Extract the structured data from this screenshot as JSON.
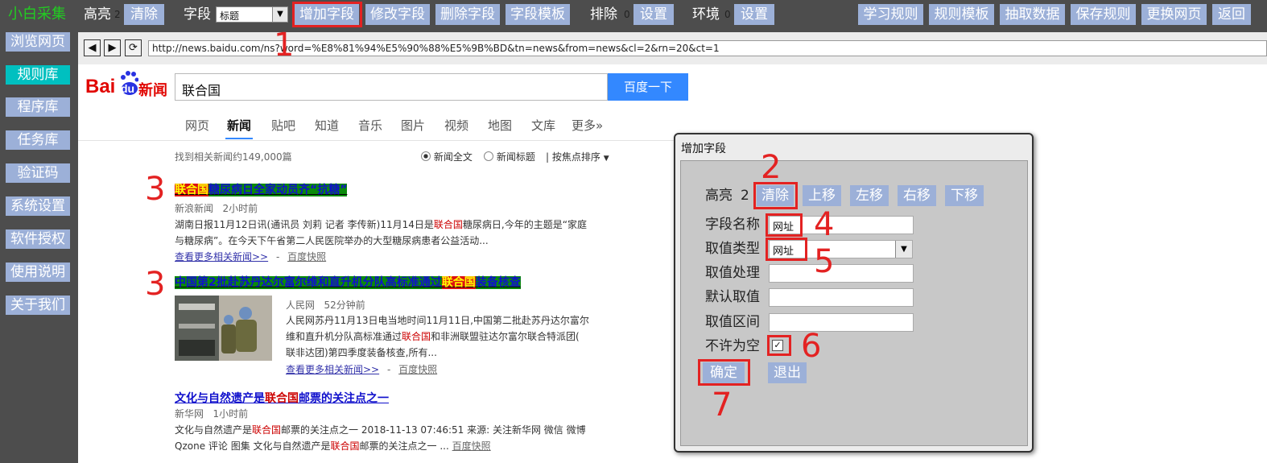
{
  "toolbar": {
    "brand": "小白采集",
    "highlight_label": "高亮",
    "highlight_count": "2",
    "clear": "清除",
    "field_label": "字段",
    "field_select": "标题",
    "add_field": "增加字段",
    "edit_field": "修改字段",
    "delete_field": "删除字段",
    "field_template": "字段模板",
    "exclude_label": "排除",
    "exclude_count": "0",
    "exclude_set": "设置",
    "env_label": "环境",
    "env_count": "0",
    "env_set": "设置",
    "learn_rules": "学习规则",
    "rule_template": "规则模板",
    "extract_data": "抽取数据",
    "save_rules": "保存规则",
    "change_page": "更换网页",
    "back": "返回"
  },
  "sidebar": {
    "items": [
      {
        "label": "浏览网页"
      },
      {
        "label": "规则库"
      },
      {
        "label": "程序库"
      },
      {
        "label": "任务库"
      },
      {
        "label": "验证码"
      },
      {
        "label": "系统设置"
      },
      {
        "label": "软件授权"
      },
      {
        "label": "使用说明"
      },
      {
        "label": "关于我们"
      }
    ]
  },
  "browser": {
    "back_glyph": "◀",
    "forward_glyph": "▶",
    "refresh_glyph": "⟳",
    "url": "http://news.baidu.com/ns?word=%E8%81%94%E5%90%88%E5%9B%BD&tn=news&from=news&cl=2&rn=20&ct=1"
  },
  "baidu": {
    "logo_bai": "Bai",
    "logo_du": "du",
    "logo_news": "新闻",
    "query": "联合国",
    "search_button": "百度一下",
    "tabs": [
      "网页",
      "新闻",
      "贴吧",
      "知道",
      "音乐",
      "图片",
      "视频",
      "地图",
      "文库",
      "更多»"
    ],
    "result_count": "找到相关新闻约149,000篇",
    "option_full": "新闻全文",
    "option_title": "新闻标题",
    "sort": "| 按焦点排序",
    "results": [
      {
        "title_a": "联合国",
        "title_b": "糖尿病日全家动员齐“抗糖”",
        "source": "新浪新闻",
        "time": "2小时前",
        "snippet_1a": "湖南日报11月12日讯(通讯员 刘莉 记者 李传新)11月14日是",
        "snippet_1b": "联合国",
        "snippet_1c": "糖尿病日,今年的主题是“家庭",
        "snippet_2": "与糖尿病”。在今天下午省第二人民医院举办的大型糖尿病患者公益活动...",
        "more": "查看更多相关新闻>>",
        "sep": "-",
        "cache": "百度快照"
      },
      {
        "title_a": "中国第2批赴苏丹达尔富尔维和直升机分队高标准通过",
        "title_b": "联合国",
        "title_c": "装备核查",
        "source": "人民网",
        "time": "52分钟前",
        "snippet_1": "人民网苏丹11月13日电当地时间11月11日,中国第二批赴苏丹达尔富尔",
        "snippet_2a": "维和直升机分队高标准通过",
        "snippet_2b": "联合国",
        "snippet_2c": "和非洲联盟驻达尔富尔联合特派团(",
        "snippet_3": "联非达团)第四季度装备核查,所有...",
        "more": "查看更多相关新闻>>",
        "sep": "-",
        "cache": "百度快照"
      },
      {
        "title_a": "文化与自然遗产是",
        "title_b": "联合国",
        "title_c": "邮票的关注点之一",
        "source": "新华网",
        "time": "1小时前",
        "snippet_1a": "文化与自然遗产是",
        "snippet_1b": "联合国",
        "snippet_1c": "邮票的关注点之一 2018-11-13 07:46:51 来源: 关注新华网 微信 微博",
        "snippet_2a": "Qzone 评论 图集 文化与自然遗产是",
        "snippet_2b": "联合国",
        "snippet_2c": "邮票的关注点之一 ...",
        "cache": "百度快照"
      }
    ]
  },
  "dialog": {
    "title": "增加字段",
    "highlight_label": "高亮",
    "highlight_count": "2",
    "clear": "清除",
    "move_up": "上移",
    "move_left": "左移",
    "move_right": "右移",
    "move_down": "下移",
    "field_name_label": "字段名称",
    "field_name_value": "网址",
    "value_type_label": "取值类型",
    "value_type_value": "网址",
    "value_process_label": "取值处理",
    "default_value_label": "默认取值",
    "value_range_label": "取值区间",
    "not_empty_label": "不许为空",
    "not_empty_checked": "✓",
    "ok": "确定",
    "exit": "退出"
  },
  "annotations": [
    "1",
    "2",
    "3",
    "3",
    "4",
    "5",
    "6",
    "7"
  ],
  "colors": {
    "toolbar_bg": "#4d4d4d",
    "button_bg": "#9cb0d8",
    "brand_green": "#22cc22",
    "active_sidebar": "#00c0c0",
    "annotation_red": "#e32222",
    "baidu_blue": "#3388ff",
    "dialog_bg": "#c8c8c8"
  }
}
